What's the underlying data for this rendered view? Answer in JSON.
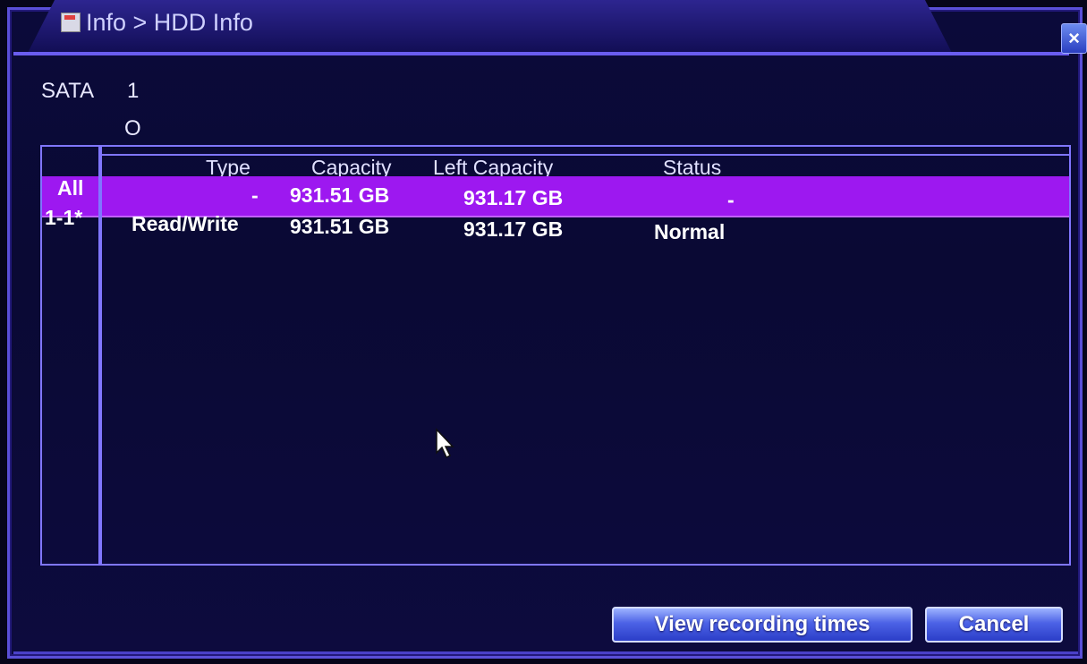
{
  "window": {
    "title": "Info > HDD Info",
    "close_label": "×"
  },
  "disk": {
    "bus": "SATA",
    "port": "1",
    "state": "O"
  },
  "table": {
    "headers": [
      "Type",
      "Capacity",
      "Left Capacity",
      "Status"
    ],
    "rows": [
      {
        "id": "All",
        "type": "-",
        "capacity": "931.51 GB",
        "left": "931.17 GB",
        "status": "-"
      },
      {
        "id": "1-1*",
        "type": "Read/Write",
        "capacity": "931.51 GB",
        "left": "931.17 GB",
        "status": "Normal"
      }
    ]
  },
  "buttons": {
    "view_recording_times": "View recording times",
    "cancel": "Cancel"
  },
  "colors": {
    "selected_row": "#9d18f0",
    "border": "#8076ff",
    "background": "#0b0a3a"
  },
  "icons": [
    "hdd-info-icon",
    "close-icon",
    "mouse-pointer-icon"
  ]
}
